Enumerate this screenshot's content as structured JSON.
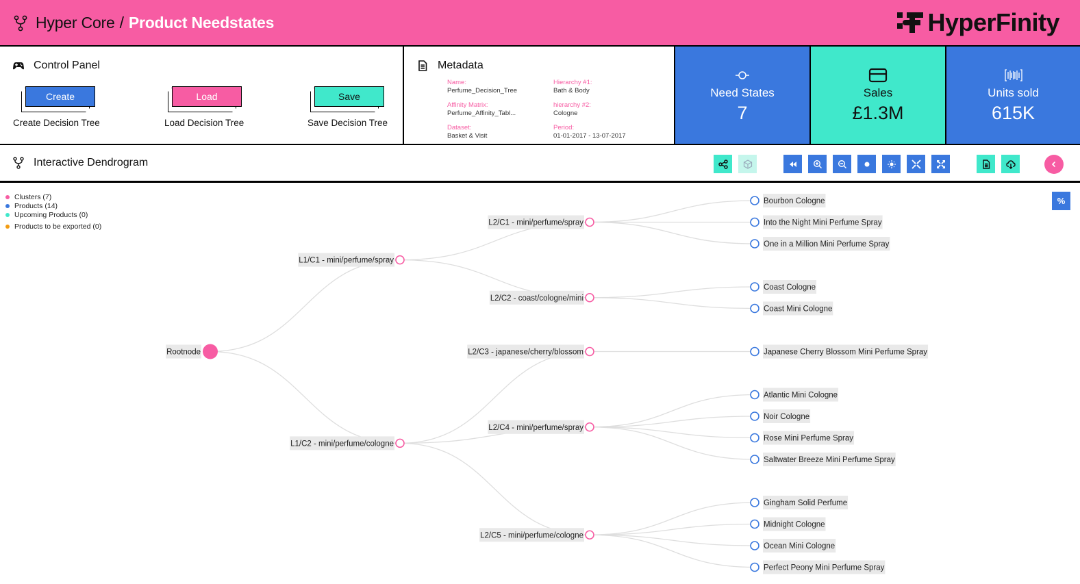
{
  "header": {
    "breadcrumb_root": "Hyper Core",
    "breadcrumb_sep": "/",
    "page_title": "Product Needstates",
    "brand_name": "HyperFinity"
  },
  "colors": {
    "pink": "#f75ca3",
    "blue": "#3a78de",
    "teal": "#40e8cb",
    "orange": "#f39c12"
  },
  "control_panel": {
    "title": "Control Panel",
    "buttons": [
      {
        "label": "Create",
        "caption": "Create Decision Tree"
      },
      {
        "label": "Load",
        "caption": "Load Decision Tree"
      },
      {
        "label": "Save",
        "caption": "Save Decision Tree"
      }
    ]
  },
  "metadata": {
    "title": "Metadata",
    "fields": [
      {
        "key": "Name:",
        "value": "Perfume_Decision_Tree"
      },
      {
        "key": "Hierarchy #1:",
        "value": "Bath & Body"
      },
      {
        "key": "Affinity Matrix:",
        "value": "Perfume_Affinity_Tabl..."
      },
      {
        "key": "hierarchy #2:",
        "value": "Cologne"
      },
      {
        "key": "Dataset:",
        "value": "Basket & Visit"
      },
      {
        "key": "Period:",
        "value": "01-01-2017 - 13-07-2017"
      }
    ]
  },
  "kpis": [
    {
      "icon": "node-icon",
      "label": "Need States",
      "value": "7"
    },
    {
      "icon": "card-icon",
      "label": "Sales",
      "value": "£1.3M"
    },
    {
      "icon": "barcode-icon",
      "label": "Units sold",
      "value": "615K"
    }
  ],
  "dendrogram": {
    "title": "Interactive Dendrogram",
    "toolbar": [
      {
        "name": "share-button",
        "icon": "share-icon"
      },
      {
        "name": "package-button",
        "icon": "package-icon",
        "disabled": true
      },
      {
        "name": "rewind-button",
        "icon": "rewind-icon"
      },
      {
        "name": "zoom-in-button",
        "icon": "zoom-in-icon"
      },
      {
        "name": "zoom-out-button",
        "icon": "zoom-out-icon"
      },
      {
        "name": "center-button",
        "icon": "dot-icon"
      },
      {
        "name": "focus-button",
        "icon": "crosshair-icon"
      },
      {
        "name": "collapse-button",
        "icon": "collapse-icon"
      },
      {
        "name": "expand-button",
        "icon": "expand-icon"
      },
      {
        "name": "report-button",
        "icon": "document-icon"
      },
      {
        "name": "download-button",
        "icon": "cloud-download-icon"
      },
      {
        "name": "back-button",
        "icon": "chevron-left-icon"
      }
    ],
    "percent_button": "%",
    "legend": [
      {
        "label": "Clusters (7)",
        "color": "#f75ca3"
      },
      {
        "label": "Products (14)",
        "color": "#3a78de"
      },
      {
        "label": "Upcoming Products (0)",
        "color": "#40e8cb"
      },
      {
        "label": "Products to be exported (0)",
        "color": "#f39c12"
      }
    ],
    "tree": {
      "name": "Rootnode",
      "type": "root",
      "children": [
        {
          "name": "L1/C1 - mini/perfume/spray",
          "type": "cluster",
          "children": [
            {
              "name": "L2/C1 - mini/perfume/spray",
              "type": "cluster",
              "children": [
                {
                  "name": "Bourbon Cologne",
                  "type": "product"
                },
                {
                  "name": "Into the Night Mini Perfume Spray",
                  "type": "product"
                },
                {
                  "name": "One in a Million Mini Perfume Spray",
                  "type": "product"
                }
              ]
            },
            {
              "name": "L2/C2 - coast/cologne/mini",
              "type": "cluster",
              "children": [
                {
                  "name": "Coast Cologne",
                  "type": "product"
                },
                {
                  "name": "Coast Mini Cologne",
                  "type": "product"
                }
              ]
            }
          ]
        },
        {
          "name": "L1/C2 - mini/perfume/cologne",
          "type": "cluster",
          "children": [
            {
              "name": "L2/C3 - japanese/cherry/blossom",
              "type": "cluster",
              "children": [
                {
                  "name": "Japanese Cherry Blossom Mini Perfume Spray",
                  "type": "product"
                }
              ]
            },
            {
              "name": "L2/C4 - mini/perfume/spray",
              "type": "cluster",
              "children": [
                {
                  "name": "Atlantic Mini Cologne",
                  "type": "product"
                },
                {
                  "name": "Noir Cologne",
                  "type": "product"
                },
                {
                  "name": "Rose Mini Perfume Spray",
                  "type": "product"
                },
                {
                  "name": "Saltwater Breeze Mini Perfume Spray",
                  "type": "product"
                }
              ]
            },
            {
              "name": "L2/C5 - mini/perfume/cologne",
              "type": "cluster",
              "children": [
                {
                  "name": "Gingham Solid Perfume",
                  "type": "product"
                },
                {
                  "name": "Midnight Cologne",
                  "type": "product"
                },
                {
                  "name": "Ocean Mini Cologne",
                  "type": "product"
                },
                {
                  "name": "Perfect Peony Mini Perfume Spray",
                  "type": "product"
                }
              ]
            }
          ]
        }
      ]
    }
  }
}
